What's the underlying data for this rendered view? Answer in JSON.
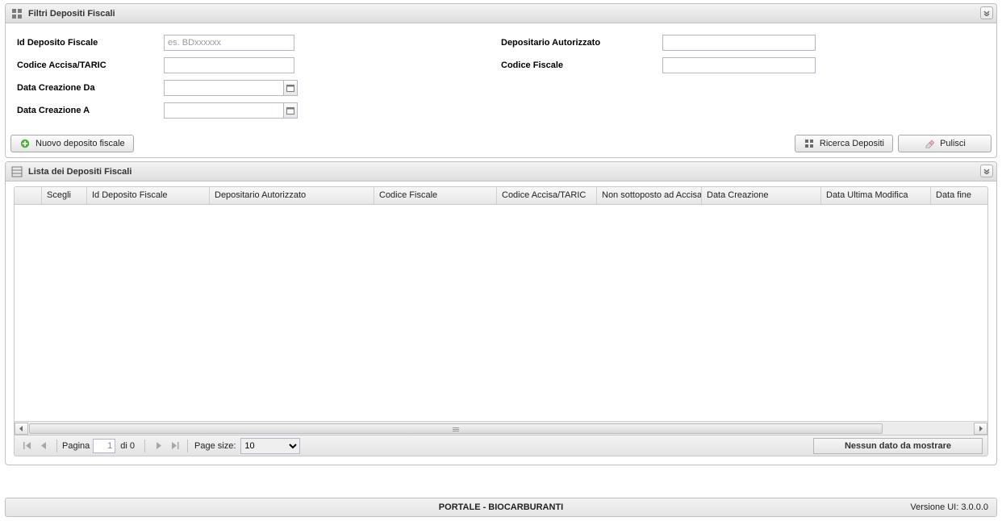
{
  "filters": {
    "title": "Filtri Depositi Fiscali",
    "fields": {
      "id_deposito_label": "Id Deposito Fiscale",
      "id_deposito_placeholder": "es. BDxxxxxx",
      "codice_accisa_label": "Codice Accisa/TARIC",
      "data_creazione_da_label": "Data Creazione Da",
      "data_creazione_a_label": "Data Creazione A",
      "depositario_label": "Depositario Autorizzato",
      "codice_fiscale_label": "Codice Fiscale"
    },
    "buttons": {
      "nuovo": "Nuovo deposito fiscale",
      "ricerca": "Ricerca Depositi",
      "pulisci": "Pulisci"
    }
  },
  "list": {
    "title": "Lista dei Depositi Fiscali",
    "columns": {
      "scegli": "Scegli",
      "id_deposito": "Id Deposito Fiscale",
      "depositario": "Depositario Autorizzato",
      "codice_fiscale": "Codice Fiscale",
      "codice_accisa": "Codice Accisa/TARIC",
      "non_sottoposto": "Non sottoposto ad Accisa",
      "data_creazione": "Data Creazione",
      "data_ultima_modifica": "Data Ultima Modifica",
      "data_fine": "Data fine"
    },
    "pager": {
      "page_label": "Pagina",
      "page_value": "1",
      "of_label": "di 0",
      "page_size_label": "Page size:",
      "page_size_value": "10",
      "status": "Nessun dato da mostrare"
    }
  },
  "footer": {
    "title": "PORTALE - BIOCARBURANTI",
    "version": "Versione UI: 3.0.0.0"
  }
}
